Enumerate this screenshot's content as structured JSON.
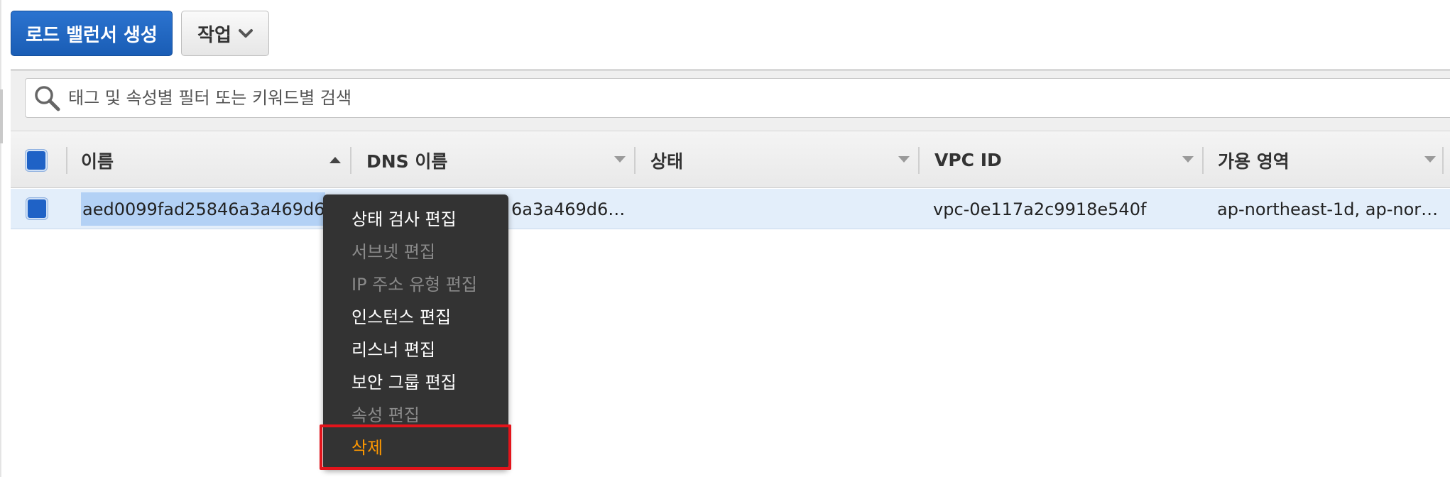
{
  "toolbar": {
    "create_button": "로드 밸런서 생성",
    "actions_button": "작업",
    "chevron_icon": "chevron-down-icon"
  },
  "search": {
    "placeholder": "태그 및 속성별 필터 또는 키워드별 검색",
    "icon": "search-icon"
  },
  "table": {
    "columns": [
      {
        "label": "이름",
        "sort": "ascending"
      },
      {
        "label": "DNS 이름",
        "sort": "none"
      },
      {
        "label": "상태",
        "sort": "none"
      },
      {
        "label": "VPC ID",
        "sort": "none"
      },
      {
        "label": "가용 영역",
        "sort": "none"
      }
    ],
    "rows": [
      {
        "selected": true,
        "name": "aed0099fad25846a3a469d6…",
        "dns_name": "6a3a469d6…",
        "state": "",
        "vpc_id": "vpc-0e117a2c9918e540f",
        "availability_zones": "ap-northeast-1d, ap-nor…"
      }
    ]
  },
  "context_menu": {
    "items": [
      {
        "label": "상태 검사 편집",
        "enabled": true
      },
      {
        "label": "서브넷 편집",
        "enabled": false
      },
      {
        "label": "IP 주소 유형 편집",
        "enabled": false
      },
      {
        "label": "인스턴스 편집",
        "enabled": true
      },
      {
        "label": "리스너 편집",
        "enabled": true
      },
      {
        "label": "보안 그룹 편집",
        "enabled": true
      },
      {
        "label": "속성 편집",
        "enabled": false
      },
      {
        "label": "삭제",
        "enabled": true,
        "highlighted": true
      }
    ]
  },
  "colors": {
    "primary_button": "#1a5db5",
    "menu_background": "#333333",
    "delete_text": "#ff9900",
    "highlight_outline": "#e3141b",
    "selected_row": "#e3eefa"
  }
}
